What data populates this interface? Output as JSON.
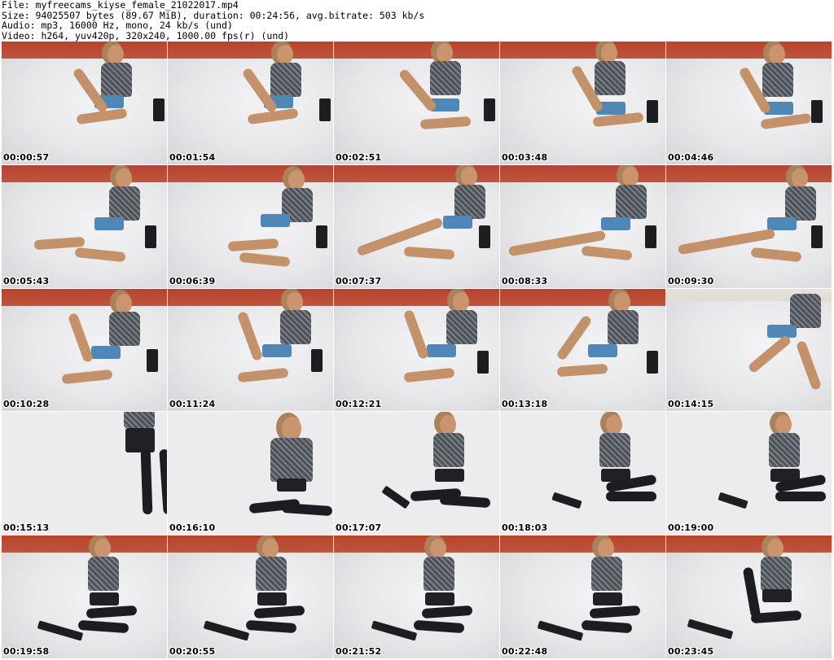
{
  "header": {
    "file_line": "File: myfreecams_kiyse_female_21022017.mp4",
    "size_line": "Size: 94025507 bytes (89.67 MiB), duration: 00:24:56, avg.bitrate: 503 kb/s",
    "audio_line": "Audio: mp3, 16000 Hz, mono, 24 kb/s (und)",
    "video_line": "Video: h264, yuv420p, 320x240, 1000.00 fps(r) (und)"
  },
  "thumbnails": [
    {
      "timestamp": "00:00:57"
    },
    {
      "timestamp": "00:01:54"
    },
    {
      "timestamp": "00:02:51"
    },
    {
      "timestamp": "00:03:48"
    },
    {
      "timestamp": "00:04:46"
    },
    {
      "timestamp": "00:05:43"
    },
    {
      "timestamp": "00:06:39"
    },
    {
      "timestamp": "00:07:37"
    },
    {
      "timestamp": "00:08:33"
    },
    {
      "timestamp": "00:09:30"
    },
    {
      "timestamp": "00:10:28"
    },
    {
      "timestamp": "00:11:24"
    },
    {
      "timestamp": "00:12:21"
    },
    {
      "timestamp": "00:13:18"
    },
    {
      "timestamp": "00:14:15"
    },
    {
      "timestamp": "00:15:13"
    },
    {
      "timestamp": "00:16:10"
    },
    {
      "timestamp": "00:17:07"
    },
    {
      "timestamp": "00:18:03"
    },
    {
      "timestamp": "00:19:00"
    },
    {
      "timestamp": "00:19:58"
    },
    {
      "timestamp": "00:20:55"
    },
    {
      "timestamp": "00:21:52"
    },
    {
      "timestamp": "00:22:48"
    },
    {
      "timestamp": "00:23:45"
    }
  ]
}
